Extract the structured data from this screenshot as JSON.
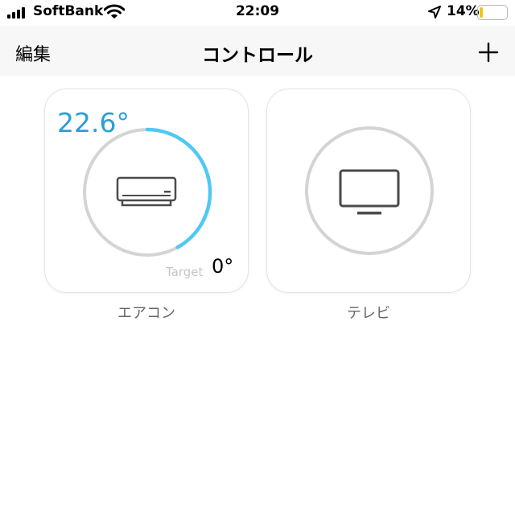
{
  "status_bar": {
    "carrier": "SoftBank",
    "time": "22:09",
    "battery_percent": "14%",
    "battery_level": 0.14,
    "battery_color": "#f0c419",
    "icons": [
      "signal-icon",
      "wifi-icon",
      "location-arrow-icon",
      "battery-icon"
    ]
  },
  "nav": {
    "edit_label": "編集",
    "title": "コントロール",
    "add_icon": "plus-icon"
  },
  "devices": [
    {
      "name": "エアコン",
      "icon": "air-conditioner-icon",
      "current_temp": "22.6°",
      "target_label": "Target",
      "target_temp": "0°",
      "ring_progress": 0.42,
      "accent_color": "#4fc8f5",
      "temp_color": "#2a9fd8"
    },
    {
      "name": "テレビ",
      "icon": "tv-icon"
    }
  ]
}
